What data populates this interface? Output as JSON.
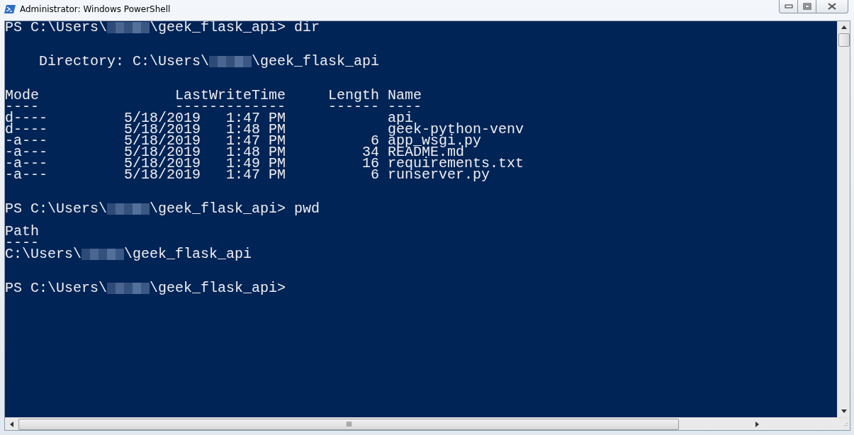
{
  "window": {
    "title": "Administrator: Windows PowerShell"
  },
  "console": [
    {
      "kind": "line",
      "segments": [
        {
          "kind": "text",
          "text": "PS C:\\Users\\"
        },
        {
          "kind": "redacted"
        },
        {
          "kind": "text",
          "text": "\\geek_flask_api> dir"
        }
      ]
    },
    {
      "kind": "blank"
    },
    {
      "kind": "blank"
    },
    {
      "kind": "line",
      "segments": [
        {
          "kind": "text",
          "text": "    Directory: C:\\Users\\"
        },
        {
          "kind": "redacted"
        },
        {
          "kind": "text",
          "text": "\\geek_flask_api"
        }
      ]
    },
    {
      "kind": "blank"
    },
    {
      "kind": "blank"
    },
    {
      "kind": "table",
      "columns": [
        {
          "heading": "Mode",
          "rule": "----"
        },
        {
          "heading": "LastWriteTime",
          "rule": "-------------"
        },
        {
          "heading": "Length",
          "rule": "------"
        },
        {
          "heading": "Name",
          "rule": "----"
        }
      ],
      "rows": [
        [
          "d----",
          "5/18/2019   1:47 PM",
          "",
          "api"
        ],
        [
          "d----",
          "5/18/2019   1:48 PM",
          "",
          "geek-python-venv"
        ],
        [
          "-a---",
          "5/18/2019   1:47 PM",
          "6",
          "app_wsgi.py"
        ],
        [
          "-a---",
          "5/18/2019   1:48 PM",
          "34",
          "README.md"
        ],
        [
          "-a---",
          "5/18/2019   1:49 PM",
          "16",
          "requirements.txt"
        ],
        [
          "-a---",
          "5/18/2019   1:47 PM",
          "6",
          "runserver.py"
        ]
      ]
    },
    {
      "kind": "blank"
    },
    {
      "kind": "blank"
    },
    {
      "kind": "line",
      "segments": [
        {
          "kind": "text",
          "text": "PS C:\\Users\\"
        },
        {
          "kind": "redacted"
        },
        {
          "kind": "text",
          "text": "\\geek_flask_api> pwd"
        }
      ]
    },
    {
      "kind": "blank"
    },
    {
      "kind": "line",
      "segments": [
        {
          "kind": "text",
          "text": "Path"
        }
      ]
    },
    {
      "kind": "line",
      "segments": [
        {
          "kind": "text",
          "text": "----"
        }
      ]
    },
    {
      "kind": "line",
      "segments": [
        {
          "kind": "text",
          "text": "C:\\Users\\"
        },
        {
          "kind": "redacted"
        },
        {
          "kind": "text",
          "text": "\\geek_flask_api"
        }
      ]
    },
    {
      "kind": "blank"
    },
    {
      "kind": "blank"
    },
    {
      "kind": "line",
      "segments": [
        {
          "kind": "text",
          "text": "PS C:\\Users\\"
        },
        {
          "kind": "redacted"
        },
        {
          "kind": "text",
          "text": "\\geek_flask_api>"
        }
      ]
    }
  ]
}
